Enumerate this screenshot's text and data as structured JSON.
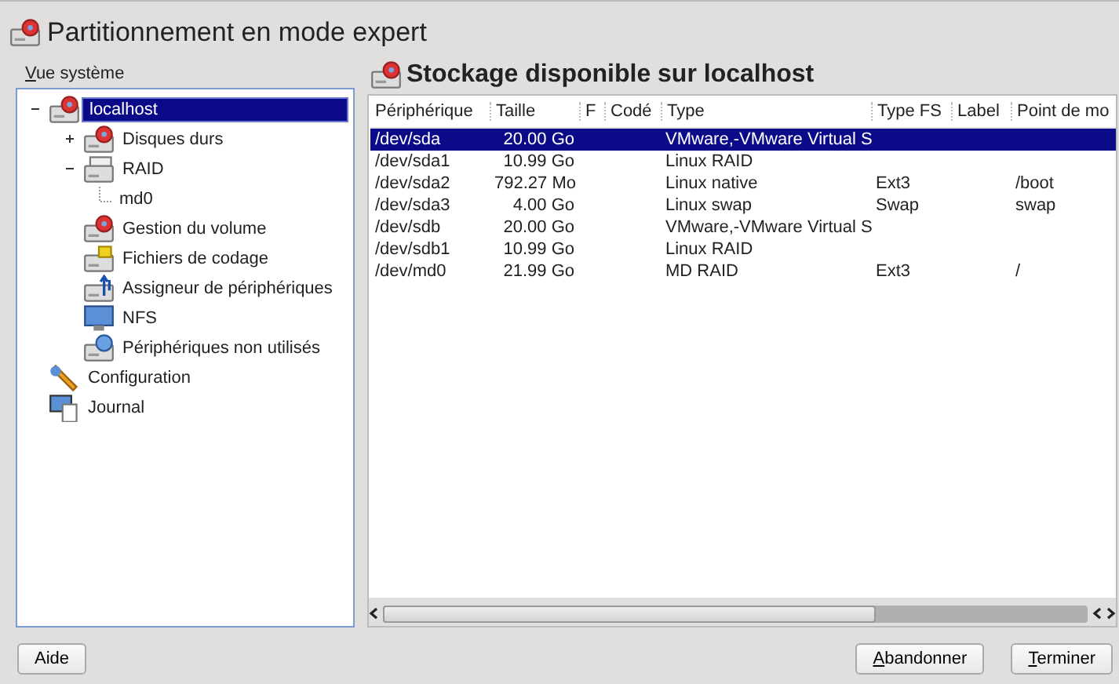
{
  "window": {
    "title": "Partitionnement en mode expert"
  },
  "sidebar": {
    "label": "Vue système",
    "tree": [
      {
        "label": "localhost",
        "kind": "host",
        "selected": true,
        "expanded": true,
        "children": [
          {
            "label": "Disques durs",
            "kind": "disks",
            "selected": false,
            "expanded": false
          },
          {
            "label": "RAID",
            "kind": "raid",
            "selected": false,
            "expanded": true,
            "children": [
              {
                "label": "md0",
                "kind": "partition",
                "selected": false
              }
            ]
          },
          {
            "label": "Gestion du volume",
            "kind": "volume",
            "selected": false
          },
          {
            "label": "Fichiers de codage",
            "kind": "crypt",
            "selected": false
          },
          {
            "label": "Assigneur de périphériques",
            "kind": "mapper",
            "selected": false
          },
          {
            "label": "NFS",
            "kind": "nfs",
            "selected": false
          },
          {
            "label": "Périphériques non utilisés",
            "kind": "unused",
            "selected": false
          }
        ]
      },
      {
        "label": "Configuration",
        "kind": "config",
        "selected": false
      },
      {
        "label": "Journal",
        "kind": "log",
        "selected": false
      }
    ]
  },
  "main": {
    "heading": "Stockage disponible sur localhost",
    "table": {
      "columns": [
        "Périphérique",
        "Taille",
        "F",
        "Codé",
        "Type",
        "Type FS",
        "Label",
        "Point de mo"
      ],
      "rows": [
        {
          "cells": [
            "/dev/sda",
            "20.00 Go",
            "",
            "",
            "VMware,-VMware Virtual S",
            "",
            "",
            ""
          ],
          "selected": true
        },
        {
          "cells": [
            "/dev/sda1",
            "10.99 Go",
            "",
            "",
            "Linux RAID",
            "",
            "",
            ""
          ],
          "selected": false
        },
        {
          "cells": [
            "/dev/sda2",
            "792.27 Mo",
            "",
            "",
            "Linux native",
            "Ext3",
            "",
            "/boot"
          ],
          "selected": false
        },
        {
          "cells": [
            "/dev/sda3",
            "4.00 Go",
            "",
            "",
            "Linux swap",
            "Swap",
            "",
            "swap"
          ],
          "selected": false
        },
        {
          "cells": [
            "/dev/sdb",
            "20.00 Go",
            "",
            "",
            "VMware,-VMware Virtual S",
            "",
            "",
            ""
          ],
          "selected": false
        },
        {
          "cells": [
            "/dev/sdb1",
            "10.99 Go",
            "",
            "",
            "Linux RAID",
            "",
            "",
            ""
          ],
          "selected": false
        },
        {
          "cells": [
            "/dev/md0",
            "21.99 Go",
            "",
            "",
            "MD RAID",
            "Ext3",
            "",
            "/"
          ],
          "selected": false
        }
      ]
    }
  },
  "buttons": {
    "help": "Aide",
    "abort": "Abandonner",
    "finish": "Terminer"
  }
}
